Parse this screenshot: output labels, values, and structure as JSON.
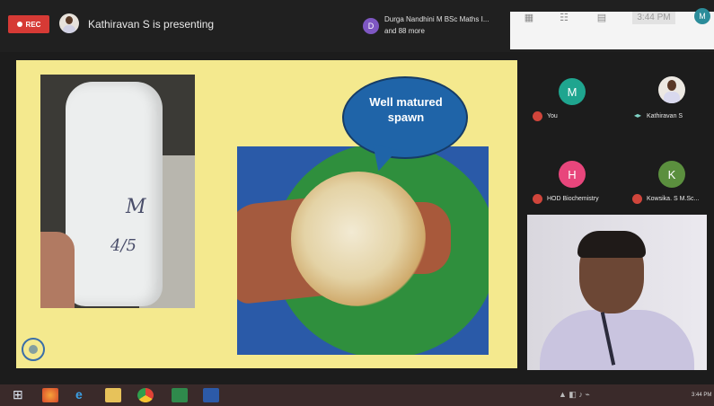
{
  "topbar": {
    "rec_label": "REC",
    "presenting_text": "Kathiravan S is presenting",
    "others_initial": "D",
    "others_line1": "Durga Nandhini M BSc Maths I...",
    "others_line2": "and 88 more"
  },
  "system_tray": {
    "clock": "3:44 PM",
    "user_initial": "M"
  },
  "slide": {
    "bubble_text": "Well matured spawn",
    "bag_marks": [
      "M",
      "4/5"
    ]
  },
  "participants": [
    {
      "initial": "M",
      "name": "You",
      "color": "#1fa58f",
      "mic": "off"
    },
    {
      "initial": "",
      "name": "Kathiravan S",
      "color": "#ece8e2",
      "mic": "on"
    },
    {
      "initial": "H",
      "name": "HOD Biochemistry",
      "color": "#e8467c",
      "mic": "off"
    },
    {
      "initial": "K",
      "name": "Kowsika. S M.Sc...",
      "color": "#5b8f3e",
      "mic": "off"
    }
  ],
  "taskbar": {
    "clock": "3:44 PM",
    "icons": [
      "windows-start-icon",
      "firefox-icon",
      "internet-explorer-icon",
      "file-explorer-icon",
      "chrome-icon",
      "excel-icon",
      "word-icon"
    ]
  }
}
